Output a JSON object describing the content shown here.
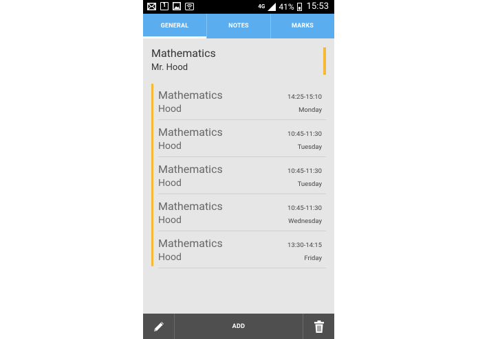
{
  "status_bar": {
    "left_icons": [
      "mail-icon",
      "calendar-icon",
      "image-icon",
      "wifi-icon"
    ],
    "calendar_day": "1",
    "network": "4G",
    "battery": "41%",
    "time": "15:53"
  },
  "tabs": [
    {
      "label": "GENERAL",
      "active": true
    },
    {
      "label": "NOTES",
      "active": false
    },
    {
      "label": "MARKS",
      "active": false
    }
  ],
  "subject_header": {
    "title": "Mathematics",
    "teacher": "Mr. Hood"
  },
  "lessons": [
    {
      "subject": "Mathematics",
      "teacher": "Hood",
      "time": "14:25-15:10",
      "day": "Monday"
    },
    {
      "subject": "Mathematics",
      "teacher": "Hood",
      "time": "10:45-11:30",
      "day": "Tuesday"
    },
    {
      "subject": "Mathematics",
      "teacher": "Hood",
      "time": "10:45-11:30",
      "day": "Tuesday"
    },
    {
      "subject": "Mathematics",
      "teacher": "Hood",
      "time": "10:45-11:30",
      "day": "Wednesday"
    },
    {
      "subject": "Mathematics",
      "teacher": "Hood",
      "time": "13:30-14:15",
      "day": "Friday"
    }
  ],
  "bottom_bar": {
    "edit_icon": "pencil-icon",
    "add_label": "ADD",
    "delete_icon": "trash-icon"
  },
  "colors": {
    "tab_bar": "#5aaeef",
    "accent": "#f5b936",
    "bottom_bar": "#4f4f4f",
    "background": "#e6e6e6"
  }
}
